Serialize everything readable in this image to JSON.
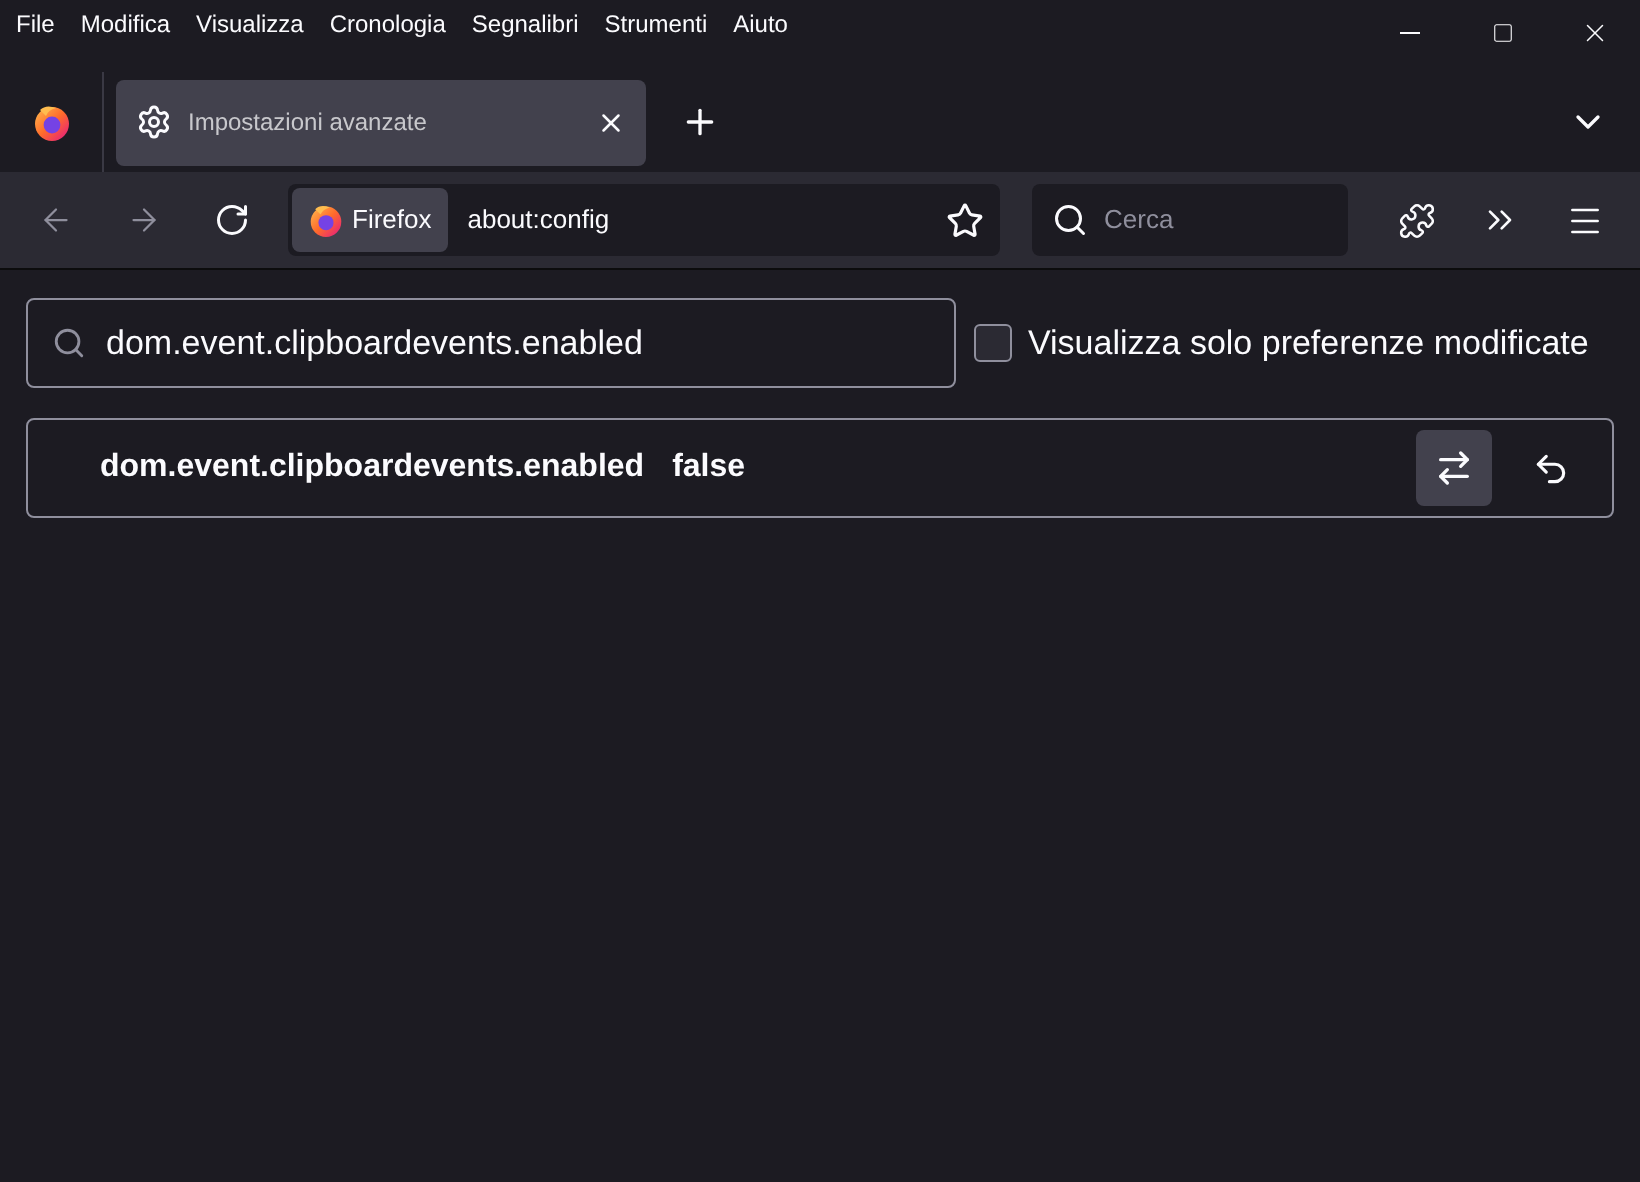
{
  "menu_bar": [
    "File",
    "Modifica",
    "Visualizza",
    "Cronologia",
    "Segnalibri",
    "Strumenti",
    "Aiuto"
  ],
  "tabs": [
    {
      "label": "Impostazioni avanzate",
      "selected": true
    }
  ],
  "toolbar": {
    "identity": "Firefox",
    "url": "about:config",
    "search": {
      "placeholder": "Cerca"
    }
  },
  "config": {
    "search": {
      "value": "dom.event.clipboardevents.enabled"
    },
    "filter": {
      "label": "Visualizza solo preferenze modificate",
      "checked": false
    },
    "preferences": [
      {
        "name": "dom.event.clipboardevents.enabled",
        "value": "false"
      }
    ]
  }
}
